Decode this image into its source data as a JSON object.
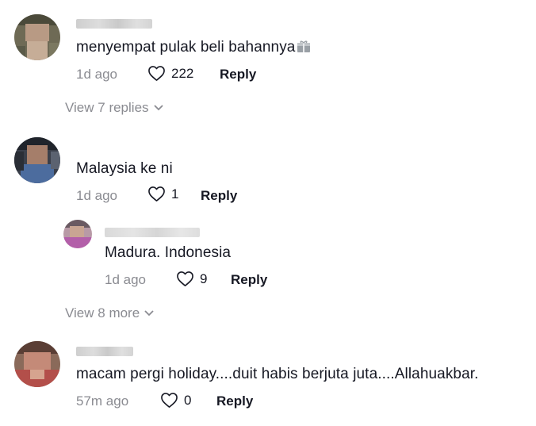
{
  "comments": [
    {
      "text": "menyempat pulak beli bahannya",
      "emoji": "gift-box-emoji",
      "time": "1d ago",
      "likes": "222",
      "reply_label": "Reply",
      "view_replies": "View 7 replies"
    },
    {
      "text": "Malaysia ke ni",
      "time": "1d ago",
      "likes": "1",
      "reply_label": "Reply",
      "reply": {
        "text": "Madura. Indonesia",
        "time": "1d ago",
        "likes": "9",
        "reply_label": "Reply"
      },
      "view_more": "View 8 more"
    },
    {
      "text": "macam pergi holiday....duit habis berjuta juta....Allahuakbar.",
      "time": "57m ago",
      "likes": "0",
      "reply_label": "Reply"
    }
  ],
  "colors": {
    "text": "#161823",
    "muted": "#8a8b91",
    "background": "#ffffff"
  }
}
